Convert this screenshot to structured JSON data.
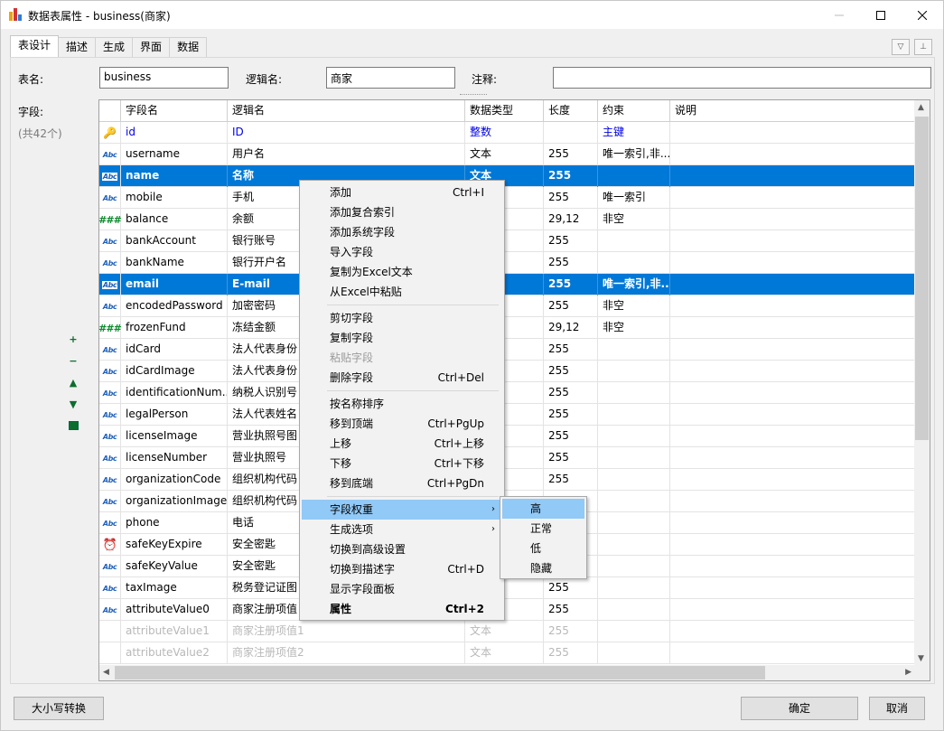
{
  "window": {
    "title": "数据表属性 - business(商家)"
  },
  "tabs": [
    "表设计",
    "描述",
    "生成",
    "界面",
    "数据"
  ],
  "form": {
    "table_label": "表名:",
    "table_value": "business",
    "logic_label": "逻辑名:",
    "logic_value": "商家",
    "comment_label": "注释:",
    "comment_value": "",
    "fields_label": "字段:",
    "fields_count": "(共42个)"
  },
  "grid": {
    "headers": [
      "字段名",
      "逻辑名",
      "数据类型",
      "长度",
      "约束",
      "说明"
    ],
    "rows": [
      {
        "icon": "key-icon",
        "name": "id",
        "logic": "ID",
        "type": "整数",
        "len": "",
        "cons": "主键",
        "desc": "",
        "state": "blue"
      },
      {
        "icon": "text-icon",
        "name": "username",
        "logic": "用户名",
        "type": "文本",
        "len": "255",
        "cons": "唯一索引,非...",
        "desc": "",
        "state": ""
      },
      {
        "icon": "text-icon",
        "name": "name",
        "logic": "名称",
        "type": "文本",
        "len": "255",
        "cons": "",
        "desc": "",
        "state": "sel"
      },
      {
        "icon": "text-icon",
        "name": "mobile",
        "logic": "手机",
        "type": "",
        "len": "255",
        "cons": "唯一索引",
        "desc": "",
        "state": ""
      },
      {
        "icon": "number-icon",
        "name": "balance",
        "logic": "余额",
        "type": "",
        "len": "29,12",
        "cons": "非空",
        "desc": "",
        "state": ""
      },
      {
        "icon": "text-icon",
        "name": "bankAccount",
        "logic": "银行账号",
        "type": "",
        "len": "255",
        "cons": "",
        "desc": "",
        "state": ""
      },
      {
        "icon": "text-icon",
        "name": "bankName",
        "logic": "银行开户名",
        "type": "",
        "len": "255",
        "cons": "",
        "desc": "",
        "state": ""
      },
      {
        "icon": "text-icon",
        "name": "email",
        "logic": "E-mail",
        "type": "",
        "len": "255",
        "cons": "唯一索引,非...",
        "desc": "",
        "state": "sel"
      },
      {
        "icon": "text-icon",
        "name": "encodedPassword",
        "logic": "加密密码",
        "type": "",
        "len": "255",
        "cons": "非空",
        "desc": "",
        "state": ""
      },
      {
        "icon": "number-icon",
        "name": "frozenFund",
        "logic": "冻结金额",
        "type": "",
        "len": "29,12",
        "cons": "非空",
        "desc": "",
        "state": ""
      },
      {
        "icon": "text-icon",
        "name": "idCard",
        "logic": "法人代表身份",
        "type": "",
        "len": "255",
        "cons": "",
        "desc": "",
        "state": ""
      },
      {
        "icon": "text-icon",
        "name": "idCardImage",
        "logic": "法人代表身份",
        "type": "",
        "len": "255",
        "cons": "",
        "desc": "",
        "state": ""
      },
      {
        "icon": "text-icon",
        "name": "identificationNum...",
        "logic": "纳税人识别号",
        "type": "",
        "len": "255",
        "cons": "",
        "desc": "",
        "state": ""
      },
      {
        "icon": "text-icon",
        "name": "legalPerson",
        "logic": "法人代表姓名",
        "type": "",
        "len": "255",
        "cons": "",
        "desc": "",
        "state": ""
      },
      {
        "icon": "text-icon",
        "name": "licenseImage",
        "logic": "营业执照号图",
        "type": "",
        "len": "255",
        "cons": "",
        "desc": "",
        "state": ""
      },
      {
        "icon": "text-icon",
        "name": "licenseNumber",
        "logic": "营业执照号",
        "type": "",
        "len": "255",
        "cons": "",
        "desc": "",
        "state": ""
      },
      {
        "icon": "text-icon",
        "name": "organizationCode",
        "logic": "组织机构代码",
        "type": "",
        "len": "255",
        "cons": "",
        "desc": "",
        "state": ""
      },
      {
        "icon": "text-icon",
        "name": "organizationImage",
        "logic": "组织机构代码",
        "type": "",
        "len": "",
        "cons": "",
        "desc": "",
        "state": ""
      },
      {
        "icon": "text-icon",
        "name": "phone",
        "logic": "电话",
        "type": "",
        "len": "",
        "cons": "",
        "desc": "",
        "state": ""
      },
      {
        "icon": "clock-icon",
        "name": "safeKeyExpire",
        "logic": "安全密匙",
        "type": "",
        "len": "",
        "cons": "",
        "desc": "",
        "state": ""
      },
      {
        "icon": "text-icon",
        "name": "safeKeyValue",
        "logic": "安全密匙",
        "type": "",
        "len": "",
        "cons": "",
        "desc": "",
        "state": ""
      },
      {
        "icon": "text-icon",
        "name": "taxImage",
        "logic": "税务登记证图",
        "type": "",
        "len": "255",
        "cons": "",
        "desc": "",
        "state": ""
      },
      {
        "icon": "text-icon",
        "name": "attributeValue0",
        "logic": "商家注册项值",
        "type": "",
        "len": "255",
        "cons": "",
        "desc": "",
        "state": ""
      },
      {
        "icon": "",
        "name": "attributeValue1",
        "logic": "商家注册项值1",
        "type": "文本",
        "len": "255",
        "cons": "",
        "desc": "",
        "state": "dim"
      },
      {
        "icon": "",
        "name": "attributeValue2",
        "logic": "商家注册项值2",
        "type": "文本",
        "len": "255",
        "cons": "",
        "desc": "",
        "state": "dim"
      }
    ]
  },
  "context_menu": {
    "groups": [
      [
        {
          "label": "添加",
          "shortcut": "Ctrl+I"
        },
        {
          "label": "添加复合索引",
          "shortcut": ""
        },
        {
          "label": "添加系统字段",
          "shortcut": ""
        },
        {
          "label": "导入字段",
          "shortcut": ""
        },
        {
          "label": "复制为Excel文本",
          "shortcut": ""
        },
        {
          "label": "从Excel中粘贴",
          "shortcut": ""
        }
      ],
      [
        {
          "label": "剪切字段",
          "shortcut": ""
        },
        {
          "label": "复制字段",
          "shortcut": ""
        },
        {
          "label": "粘贴字段",
          "shortcut": "",
          "disabled": true
        },
        {
          "label": "删除字段",
          "shortcut": "Ctrl+Del"
        }
      ],
      [
        {
          "label": "按名称排序",
          "shortcut": ""
        },
        {
          "label": "移到顶端",
          "shortcut": "Ctrl+PgUp"
        },
        {
          "label": "上移",
          "shortcut": "Ctrl+上移"
        },
        {
          "label": "下移",
          "shortcut": "Ctrl+下移"
        },
        {
          "label": "移到底端",
          "shortcut": "Ctrl+PgDn"
        }
      ],
      [
        {
          "label": "字段权重",
          "shortcut": "",
          "submenu": true,
          "highlight": true
        },
        {
          "label": "生成选项",
          "shortcut": "",
          "submenu": true
        },
        {
          "label": "切换到高级设置",
          "shortcut": ""
        },
        {
          "label": "切换到描述字",
          "shortcut": "Ctrl+D"
        },
        {
          "label": "显示字段面板",
          "shortcut": ""
        },
        {
          "label": "属性",
          "shortcut": "Ctrl+2",
          "bold": true
        }
      ]
    ]
  },
  "submenu": [
    {
      "label": "高",
      "highlight": true
    },
    {
      "label": "正常"
    },
    {
      "label": "低"
    },
    {
      "label": "隐藏"
    }
  ],
  "buttons": {
    "case_convert": "大小写转换",
    "ok": "确定",
    "cancel": "取消"
  }
}
